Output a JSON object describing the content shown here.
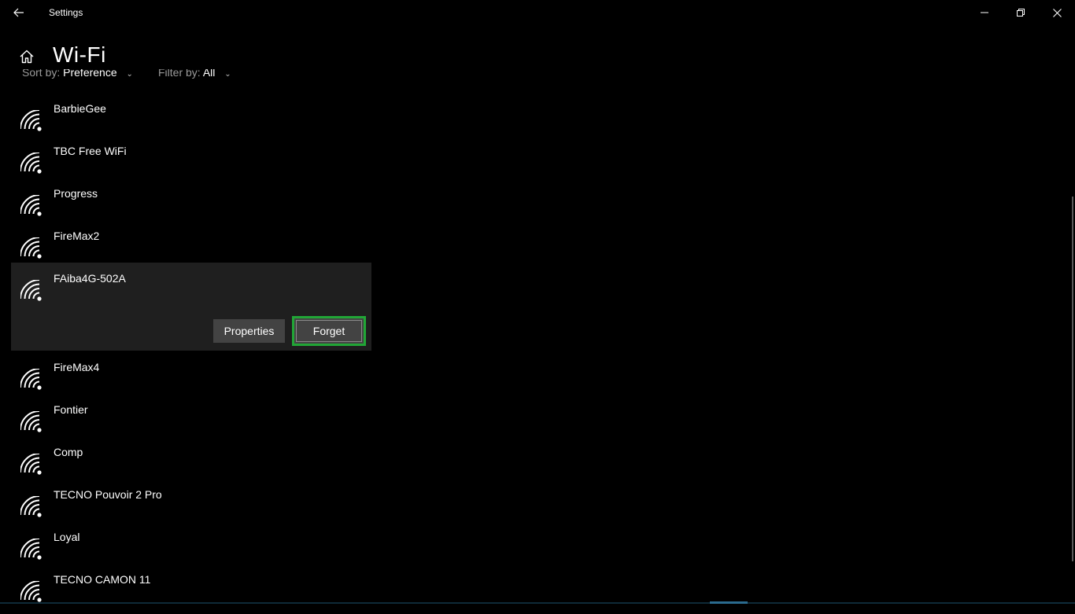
{
  "window": {
    "title": "Settings",
    "controls": [
      "minimize-icon",
      "restore-icon",
      "close-icon"
    ]
  },
  "header": {
    "title": "Wi-Fi",
    "home_icon": "home-icon",
    "back_icon": "back-arrow-icon"
  },
  "filters": {
    "sort_label": "Sort by:",
    "sort_value": "Preference",
    "filter_label": "Filter by:",
    "filter_value": "All"
  },
  "networks": [
    {
      "name": "BarbieGee"
    },
    {
      "name": "TBC Free WiFi"
    },
    {
      "name": "Progress"
    },
    {
      "name": "FireMax2"
    },
    {
      "name": "FAiba4G-502A",
      "selected": true
    },
    {
      "name": "FireMax4"
    },
    {
      "name": "Fontier"
    },
    {
      "name": "Comp"
    },
    {
      "name": "TECNO Pouvoir 2 Pro"
    },
    {
      "name": "Loyal"
    },
    {
      "name": "TECNO CAMON 11"
    }
  ],
  "selected_actions": {
    "properties_label": "Properties",
    "forget_label": "Forget"
  },
  "colors": {
    "background": "#000000",
    "selected_row": "#1f1f1f",
    "button": "#434343",
    "highlight": "#21a636"
  }
}
